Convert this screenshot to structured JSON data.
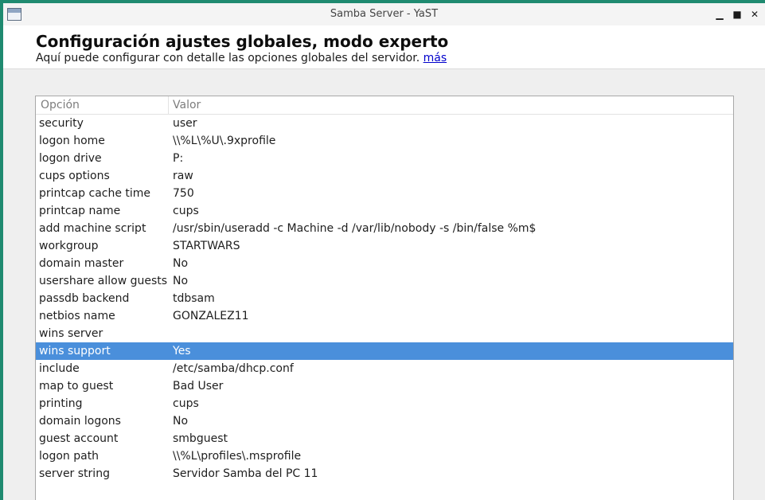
{
  "window": {
    "title": "Samba Server - YaST",
    "minimize_glyph": "▁",
    "maximize_glyph": "■",
    "close_glyph": "✕"
  },
  "header": {
    "title": "Configuración ajustes globales, modo experto",
    "description": "Aquí puede configurar con detalle las opciones globales del servidor.",
    "more_link": "más"
  },
  "table": {
    "columns": [
      "Opción",
      "Valor"
    ],
    "rows": [
      {
        "option": "security",
        "value": "user"
      },
      {
        "option": "logon home",
        "value": "\\\\%L\\%U\\.9xprofile"
      },
      {
        "option": "logon drive",
        "value": "P:"
      },
      {
        "option": "cups options",
        "value": "raw"
      },
      {
        "option": "printcap cache time",
        "value": "750"
      },
      {
        "option": "printcap name",
        "value": "cups"
      },
      {
        "option": "add machine script",
        "value": "/usr/sbin/useradd  -c Machine -d /var/lib/nobody -s /bin/false %m$"
      },
      {
        "option": "workgroup",
        "value": "STARTWARS"
      },
      {
        "option": "domain master",
        "value": "No"
      },
      {
        "option": "usershare allow guests",
        "value": "No"
      },
      {
        "option": "passdb backend",
        "value": "tdbsam"
      },
      {
        "option": "netbios name",
        "value": "GONZALEZ11"
      },
      {
        "option": "wins server",
        "value": ""
      },
      {
        "option": "wins support",
        "value": "Yes"
      },
      {
        "option": "include",
        "value": "/etc/samba/dhcp.conf"
      },
      {
        "option": "map to guest",
        "value": "Bad User"
      },
      {
        "option": "printing",
        "value": "cups"
      },
      {
        "option": "domain logons",
        "value": "No"
      },
      {
        "option": "guest account",
        "value": "smbguest"
      },
      {
        "option": "logon path",
        "value": "\\\\%L\\profiles\\.msprofile"
      },
      {
        "option": "server string",
        "value": "Servidor Samba del PC 11"
      }
    ],
    "selected_index": 13
  },
  "colors": {
    "selection": "#4a8fdb",
    "desktop": "#1f8a70"
  }
}
